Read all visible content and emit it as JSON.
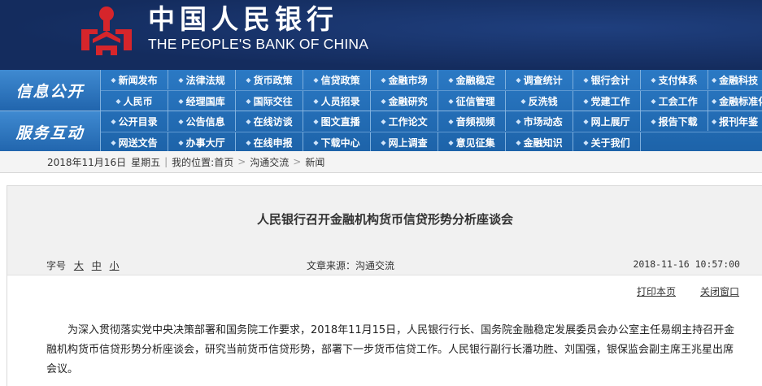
{
  "header": {
    "logo_cn": "中国人民银行",
    "logo_en": "THE PEOPLE'S BANK OF CHINA",
    "emblem_icon": "pboc-emblem-icon",
    "emblem_color": "#d6252b",
    "background_color": "#142c5e"
  },
  "nav": {
    "sections": [
      {
        "label": "信息公开",
        "rows": [
          [
            "新闻发布",
            "法律法规",
            "货币政策",
            "信贷政策",
            "金融市场",
            "金融稳定",
            "调查统计",
            "银行会计",
            "支付体系",
            "金融科技"
          ],
          [
            "人民币",
            "经理国库",
            "国际交往",
            "人员招录",
            "金融研究",
            "征信管理",
            "反洗钱",
            "党建工作",
            "工会工作",
            "金融标准化"
          ]
        ]
      },
      {
        "label": "服务互动",
        "rows": [
          [
            "公开目录",
            "公告信息",
            "在线访谈",
            "图文直播",
            "工作论文",
            "音频视频",
            "市场动态",
            "网上展厅",
            "报告下载",
            "报刊年鉴"
          ],
          [
            "网送文告",
            "办事大厅",
            "在线申报",
            "下载中心",
            "网上调查",
            "意见征集",
            "金融知识",
            "关于我们"
          ]
        ]
      }
    ]
  },
  "breadcrumb": {
    "date": "2018年11月16日",
    "weekday": "星期五",
    "location_label": "我的位置:",
    "items": [
      "首页",
      "沟通交流",
      "新闻"
    ]
  },
  "article": {
    "title": "人民银行召开金融机构货币信贷形势分析座谈会",
    "font_size_label": "字号",
    "font_sizes": [
      "大",
      "中",
      "小"
    ],
    "source": "文章来源：沟通交流",
    "time": "2018-11-16 10:57:00",
    "print_label": "打印本页",
    "close_label": "关闭窗口",
    "body": "为深入贯彻落实党中央决策部署和国务院工作要求，2018年11月15日，人民银行行长、国务院金融稳定发展委员会办公室主任易纲主持召开金融机构货币信贷形势分析座谈会，研究当前货币信贷形势，部署下一步货币信贷工作。人民银行副行长潘功胜、刘国强，银保监会副主席王兆星出席会议。"
  }
}
